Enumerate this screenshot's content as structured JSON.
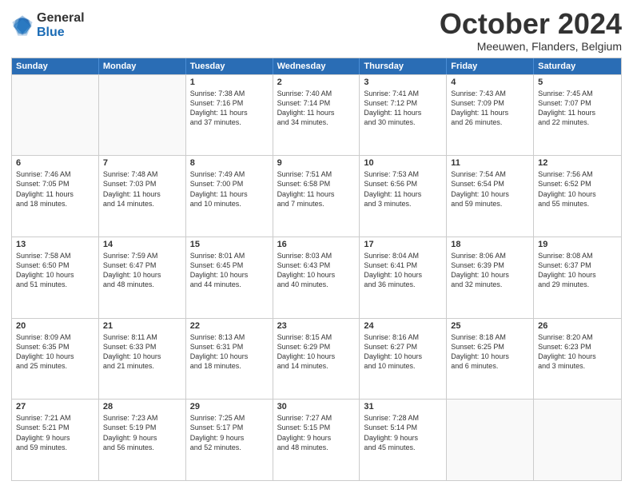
{
  "logo": {
    "general": "General",
    "blue": "Blue"
  },
  "title": "October 2024",
  "subtitle": "Meeuwen, Flanders, Belgium",
  "header_days": [
    "Sunday",
    "Monday",
    "Tuesday",
    "Wednesday",
    "Thursday",
    "Friday",
    "Saturday"
  ],
  "rows": [
    [
      {
        "day": "",
        "text": "",
        "empty": true
      },
      {
        "day": "",
        "text": "",
        "empty": true
      },
      {
        "day": "1",
        "text": "Sunrise: 7:38 AM\nSunset: 7:16 PM\nDaylight: 11 hours\nand 37 minutes."
      },
      {
        "day": "2",
        "text": "Sunrise: 7:40 AM\nSunset: 7:14 PM\nDaylight: 11 hours\nand 34 minutes."
      },
      {
        "day": "3",
        "text": "Sunrise: 7:41 AM\nSunset: 7:12 PM\nDaylight: 11 hours\nand 30 minutes."
      },
      {
        "day": "4",
        "text": "Sunrise: 7:43 AM\nSunset: 7:09 PM\nDaylight: 11 hours\nand 26 minutes."
      },
      {
        "day": "5",
        "text": "Sunrise: 7:45 AM\nSunset: 7:07 PM\nDaylight: 11 hours\nand 22 minutes."
      }
    ],
    [
      {
        "day": "6",
        "text": "Sunrise: 7:46 AM\nSunset: 7:05 PM\nDaylight: 11 hours\nand 18 minutes."
      },
      {
        "day": "7",
        "text": "Sunrise: 7:48 AM\nSunset: 7:03 PM\nDaylight: 11 hours\nand 14 minutes."
      },
      {
        "day": "8",
        "text": "Sunrise: 7:49 AM\nSunset: 7:00 PM\nDaylight: 11 hours\nand 10 minutes."
      },
      {
        "day": "9",
        "text": "Sunrise: 7:51 AM\nSunset: 6:58 PM\nDaylight: 11 hours\nand 7 minutes."
      },
      {
        "day": "10",
        "text": "Sunrise: 7:53 AM\nSunset: 6:56 PM\nDaylight: 11 hours\nand 3 minutes."
      },
      {
        "day": "11",
        "text": "Sunrise: 7:54 AM\nSunset: 6:54 PM\nDaylight: 10 hours\nand 59 minutes."
      },
      {
        "day": "12",
        "text": "Sunrise: 7:56 AM\nSunset: 6:52 PM\nDaylight: 10 hours\nand 55 minutes."
      }
    ],
    [
      {
        "day": "13",
        "text": "Sunrise: 7:58 AM\nSunset: 6:50 PM\nDaylight: 10 hours\nand 51 minutes."
      },
      {
        "day": "14",
        "text": "Sunrise: 7:59 AM\nSunset: 6:47 PM\nDaylight: 10 hours\nand 48 minutes."
      },
      {
        "day": "15",
        "text": "Sunrise: 8:01 AM\nSunset: 6:45 PM\nDaylight: 10 hours\nand 44 minutes."
      },
      {
        "day": "16",
        "text": "Sunrise: 8:03 AM\nSunset: 6:43 PM\nDaylight: 10 hours\nand 40 minutes."
      },
      {
        "day": "17",
        "text": "Sunrise: 8:04 AM\nSunset: 6:41 PM\nDaylight: 10 hours\nand 36 minutes."
      },
      {
        "day": "18",
        "text": "Sunrise: 8:06 AM\nSunset: 6:39 PM\nDaylight: 10 hours\nand 32 minutes."
      },
      {
        "day": "19",
        "text": "Sunrise: 8:08 AM\nSunset: 6:37 PM\nDaylight: 10 hours\nand 29 minutes."
      }
    ],
    [
      {
        "day": "20",
        "text": "Sunrise: 8:09 AM\nSunset: 6:35 PM\nDaylight: 10 hours\nand 25 minutes."
      },
      {
        "day": "21",
        "text": "Sunrise: 8:11 AM\nSunset: 6:33 PM\nDaylight: 10 hours\nand 21 minutes."
      },
      {
        "day": "22",
        "text": "Sunrise: 8:13 AM\nSunset: 6:31 PM\nDaylight: 10 hours\nand 18 minutes."
      },
      {
        "day": "23",
        "text": "Sunrise: 8:15 AM\nSunset: 6:29 PM\nDaylight: 10 hours\nand 14 minutes."
      },
      {
        "day": "24",
        "text": "Sunrise: 8:16 AM\nSunset: 6:27 PM\nDaylight: 10 hours\nand 10 minutes."
      },
      {
        "day": "25",
        "text": "Sunrise: 8:18 AM\nSunset: 6:25 PM\nDaylight: 10 hours\nand 6 minutes."
      },
      {
        "day": "26",
        "text": "Sunrise: 8:20 AM\nSunset: 6:23 PM\nDaylight: 10 hours\nand 3 minutes."
      }
    ],
    [
      {
        "day": "27",
        "text": "Sunrise: 7:21 AM\nSunset: 5:21 PM\nDaylight: 9 hours\nand 59 minutes."
      },
      {
        "day": "28",
        "text": "Sunrise: 7:23 AM\nSunset: 5:19 PM\nDaylight: 9 hours\nand 56 minutes."
      },
      {
        "day": "29",
        "text": "Sunrise: 7:25 AM\nSunset: 5:17 PM\nDaylight: 9 hours\nand 52 minutes."
      },
      {
        "day": "30",
        "text": "Sunrise: 7:27 AM\nSunset: 5:15 PM\nDaylight: 9 hours\nand 48 minutes."
      },
      {
        "day": "31",
        "text": "Sunrise: 7:28 AM\nSunset: 5:14 PM\nDaylight: 9 hours\nand 45 minutes."
      },
      {
        "day": "",
        "text": "",
        "empty": true
      },
      {
        "day": "",
        "text": "",
        "empty": true
      }
    ]
  ]
}
